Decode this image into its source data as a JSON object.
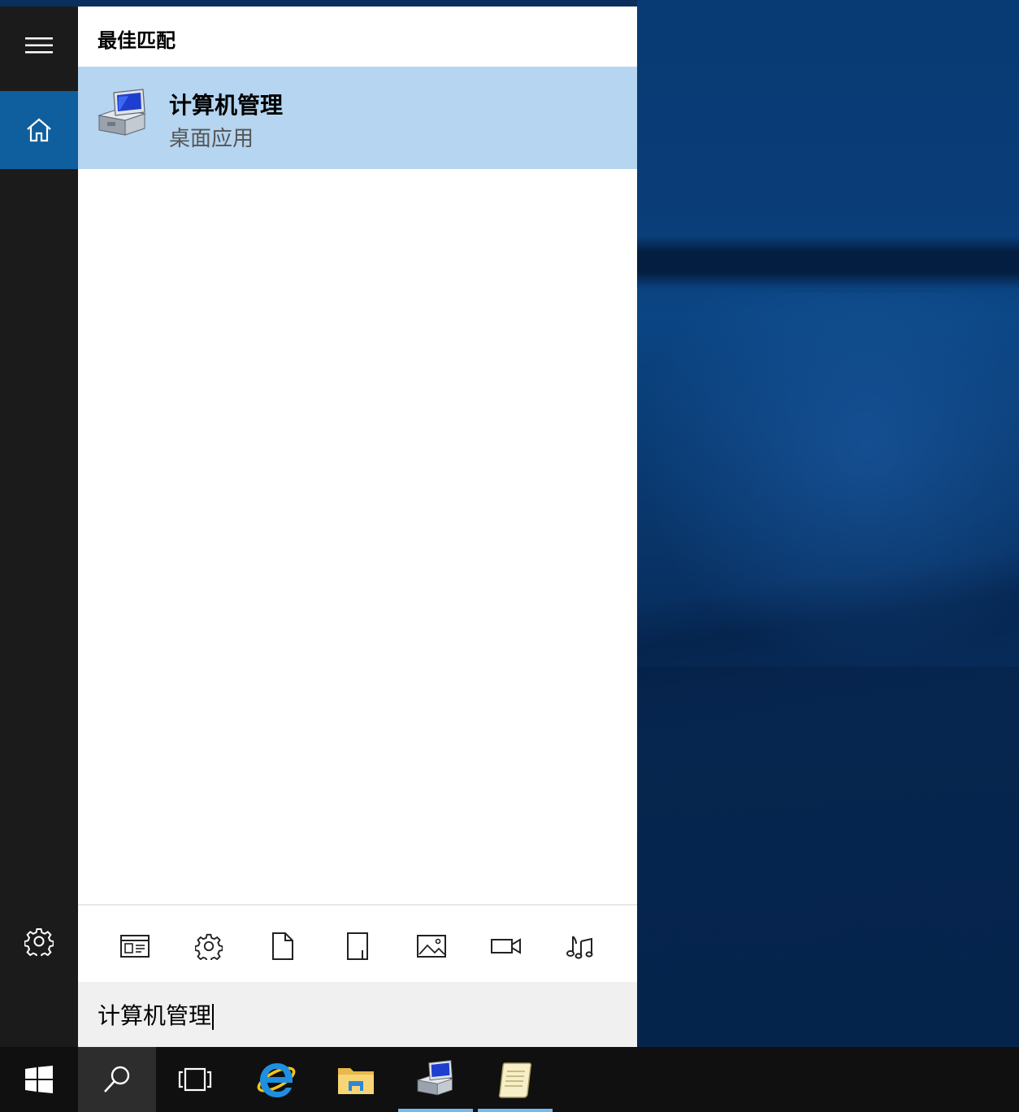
{
  "start_panel": {
    "section_title": "最佳匹配",
    "best_match": {
      "title": "计算机管理",
      "subtitle": "桌面应用",
      "icon": "computer-management-icon"
    },
    "filters": [
      {
        "icon": "apps-filter-icon"
      },
      {
        "icon": "settings-filter-icon"
      },
      {
        "icon": "documents-filter-icon"
      },
      {
        "icon": "folders-filter-icon"
      },
      {
        "icon": "photos-filter-icon"
      },
      {
        "icon": "videos-filter-icon"
      },
      {
        "icon": "music-filter-icon"
      }
    ],
    "search": {
      "value": "计算机管理"
    }
  },
  "rail": {
    "items": [
      {
        "icon": "hamburger-menu-icon"
      },
      {
        "icon": "home-icon",
        "selected": true
      },
      {
        "icon": "gear-icon"
      }
    ]
  },
  "taskbar": {
    "items": [
      {
        "icon": "windows-start-icon"
      },
      {
        "icon": "search-icon",
        "active": true
      },
      {
        "icon": "task-view-icon"
      },
      {
        "icon": "internet-explorer-icon"
      },
      {
        "icon": "file-explorer-icon"
      },
      {
        "icon": "computer-management-icon",
        "running": true
      },
      {
        "icon": "notepad-scroll-icon",
        "running": true
      }
    ]
  },
  "colors": {
    "accent": "#0f5f9e",
    "selection": "#b5d5f0",
    "rail": "#1b1b1b",
    "taskbar": "#101010",
    "running_indicator": "#76b9ed"
  }
}
